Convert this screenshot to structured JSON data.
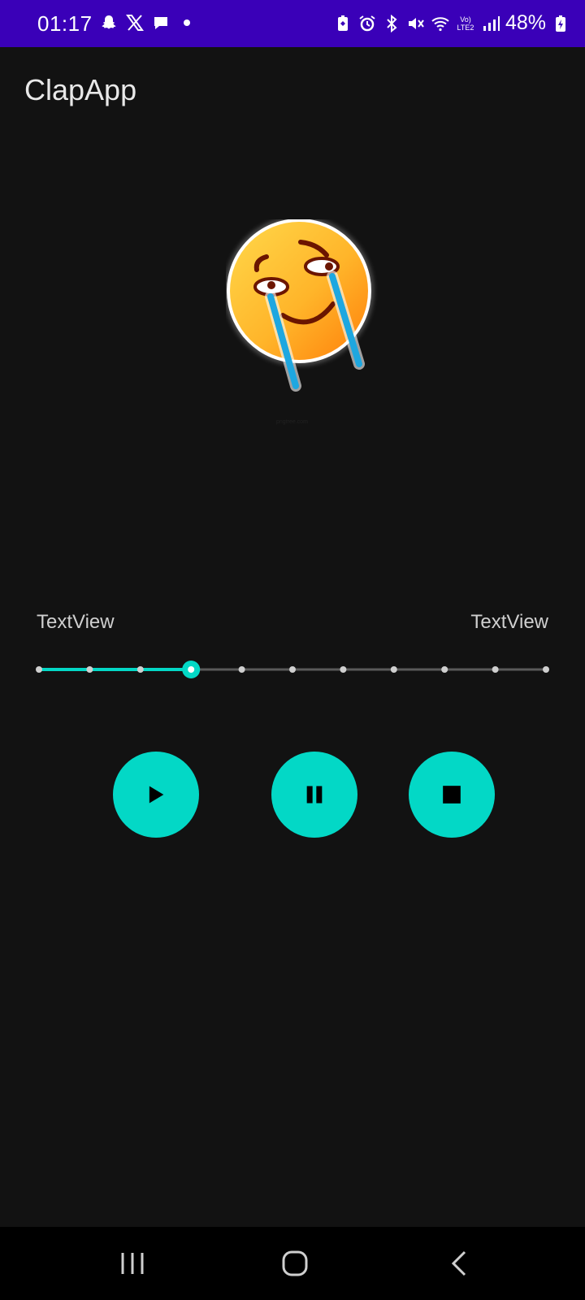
{
  "status_bar": {
    "time": "01:17",
    "battery": "48%",
    "left_icons": [
      "snapchat-icon",
      "x-icon",
      "chat-bubble-icon",
      "dot-icon"
    ],
    "right_icons": [
      "battery-saver-icon",
      "alarm-icon",
      "bluetooth-icon",
      "mute-icon",
      "wifi-icon",
      "lte-icon",
      "signal-icon",
      "battery-charging-icon"
    ],
    "network_label": "Vo) LTE2"
  },
  "app": {
    "title": "ClapApp",
    "image": {
      "icon": "crying-laughing-emoji",
      "watermark": "pngtree.com"
    }
  },
  "player": {
    "left_text": "TextView",
    "right_text": "TextView",
    "seek": {
      "steps": 10,
      "current_step": 3
    },
    "accent_color": "#03d8c6",
    "buttons": [
      {
        "name": "play-button",
        "icon": "play-icon"
      },
      {
        "name": "pause-button",
        "icon": "pause-icon"
      },
      {
        "name": "stop-button",
        "icon": "stop-icon"
      }
    ]
  },
  "nav": {
    "buttons": [
      "recent-apps-icon",
      "home-icon",
      "back-icon"
    ]
  },
  "colors": {
    "status_bar": "#3a00b8",
    "background": "#121212",
    "accent": "#03d8c6",
    "nav_bar": "#000000"
  }
}
